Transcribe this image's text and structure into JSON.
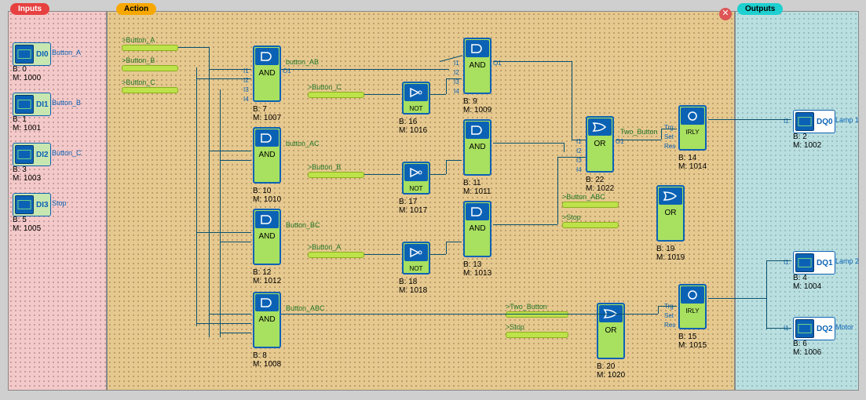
{
  "zones": {
    "inputs": "Inputs",
    "action": "Action",
    "outputs": "Outputs"
  },
  "inputs": [
    {
      "code": "DI0",
      "label": "Button_A",
      "b": "B: 0",
      "m": "M: 1000"
    },
    {
      "code": "DI1",
      "label": "Button_B",
      "b": "B: 1",
      "m": "M: 1001"
    },
    {
      "code": "DI2",
      "label": "Button_C",
      "b": "B: 3",
      "m": "M: 1003"
    },
    {
      "code": "DI3",
      "label": "Stop",
      "b": "B: 5",
      "m": "M: 1005"
    }
  ],
  "outputs": [
    {
      "code": "DQ0",
      "label": "Lamp 1",
      "b": "B: 2",
      "m": "M: 1002"
    },
    {
      "code": "DQ1",
      "label": "Lamp 2",
      "b": "B: 4",
      "m": "M: 1004"
    },
    {
      "code": "DQ2",
      "label": "Motor",
      "b": "B: 6",
      "m": "M: 1006"
    }
  ],
  "action_connectors": [
    {
      "label": ">Button_A"
    },
    {
      "label": ">Button_B"
    },
    {
      "label": ">Button_C"
    },
    {
      "label": ">Button_C"
    },
    {
      "label": ">Button_B"
    },
    {
      "label": ">Button_A"
    },
    {
      "label": ">Button_ABC"
    },
    {
      "label": ">Stop"
    },
    {
      "label": ">Two_Button"
    },
    {
      "label": ">Stop"
    }
  ],
  "gates": {
    "and": "AND",
    "or": "OR",
    "not": "NOT",
    "irly": "IRLY"
  },
  "gate_labels": {
    "ab": "button_AB",
    "ac": "button_AC",
    "bc": "Button_BC",
    "abc": "Button_ABC",
    "two": "Two_Button"
  },
  "gate_meta": {
    "and7": {
      "b": "B: 7",
      "m": "M: 1007"
    },
    "and10": {
      "b": "B: 10",
      "m": "M: 1010"
    },
    "and12": {
      "b": "B: 12",
      "m": "M: 1012"
    },
    "and8": {
      "b": "B: 8",
      "m": "M: 1008"
    },
    "not16": {
      "b": "B: 16",
      "m": "M: 1016"
    },
    "not17": {
      "b": "B: 17",
      "m": "M: 1017"
    },
    "not18": {
      "b": "B: 18",
      "m": "M: 1018"
    },
    "and9": {
      "b": "B: 9",
      "m": "M: 1009"
    },
    "and11": {
      "b": "B: 11",
      "m": "M: 1011"
    },
    "and13": {
      "b": "B: 13",
      "m": "M: 1013"
    },
    "or22": {
      "b": "B: 22",
      "m": "M: 1022"
    },
    "or19": {
      "b": "B: 19",
      "m": "M: 1019"
    },
    "or20": {
      "b": "B: 20",
      "m": "M: 1020"
    },
    "irly14": {
      "b": "B: 14",
      "m": "M: 1014"
    },
    "irly15": {
      "b": "B: 15",
      "m": "M: 1015"
    }
  },
  "pins": {
    "i1": "I1",
    "i2": "I2",
    "i3": "I3",
    "i4": "I4",
    "o1": "O1",
    "trg": "Trg",
    "set": "Set",
    "res": "Res"
  }
}
